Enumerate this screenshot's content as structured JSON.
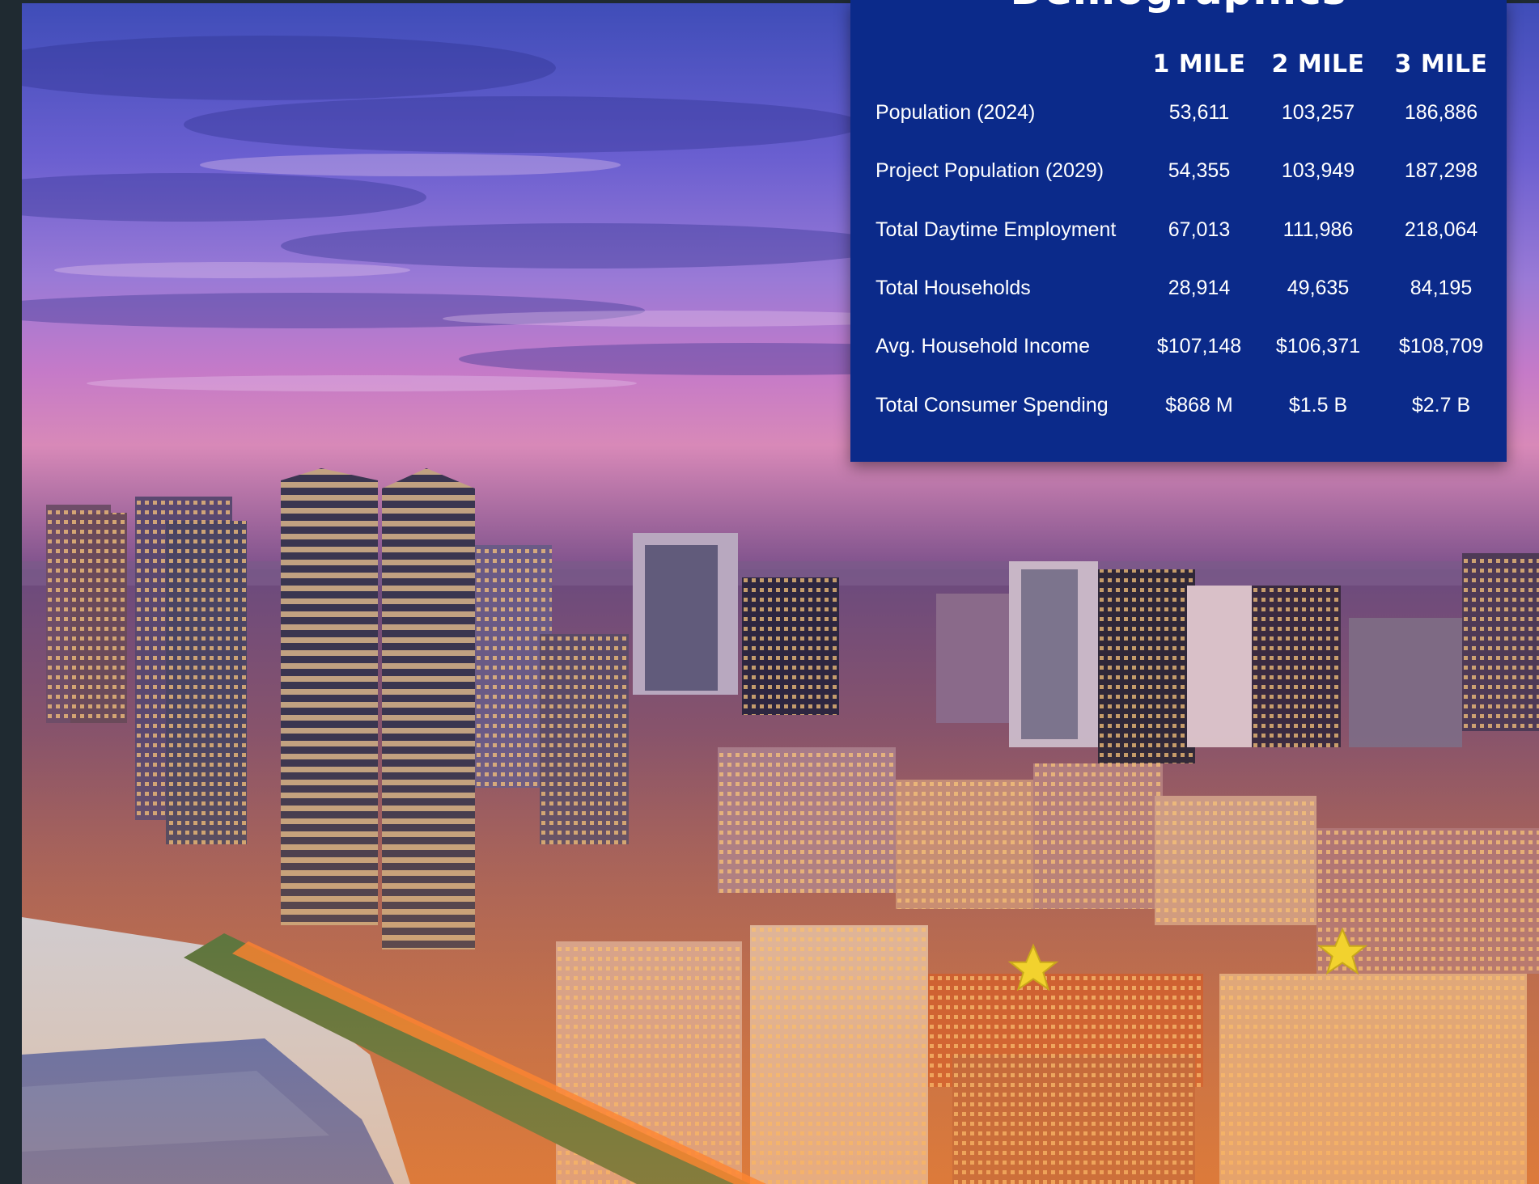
{
  "demographics": {
    "title": "Demographics",
    "columns": [
      "1 MILE",
      "2 MILE",
      "3 MILE"
    ],
    "rows": [
      {
        "label": "Population  (2024)",
        "values": [
          "53,611",
          "103,257",
          "186,886"
        ]
      },
      {
        "label": "Project Population  (2029)",
        "values": [
          "54,355",
          "103,949",
          "187,298"
        ]
      },
      {
        "label": "Total Daytime Employment",
        "values": [
          "67,013",
          "111,986",
          "218,064"
        ]
      },
      {
        "label": "Total Households",
        "values": [
          "28,914",
          "49,635",
          "84,195"
        ]
      },
      {
        "label": "Avg. Household Income",
        "values": [
          "$107,148",
          "$106,371",
          "$108,709"
        ]
      },
      {
        "label": "Total Consumer Spending",
        "values": [
          "$868 M",
          "$1.5 B",
          "$2.7 B"
        ]
      }
    ]
  },
  "colors": {
    "panel": "#0b2a8a",
    "star": "#f2d22e",
    "sky_top": "#4d57c0",
    "sky_bottom": "#c57ac8"
  },
  "icons": [
    "star-icon",
    "star-icon"
  ]
}
